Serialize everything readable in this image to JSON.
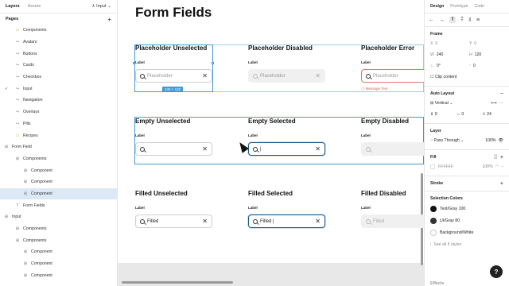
{
  "layers_panel": {
    "tab_layers": "Layers",
    "tab_assets": "Assets",
    "page_selector": "Input",
    "pages_header": "Pages",
    "rows": [
      {
        "label": "Components",
        "icon": "folder-icon",
        "indent": 1
      },
      {
        "label": "Avatars",
        "icon": "page-link-icon",
        "indent": 1
      },
      {
        "label": "Buttons",
        "icon": "page-link-icon",
        "indent": 1
      },
      {
        "label": "Cards",
        "icon": "page-link-icon",
        "indent": 1
      },
      {
        "label": "Checkbox",
        "icon": "page-link-icon",
        "indent": 1
      },
      {
        "label": "Input",
        "icon": "page-link-icon",
        "indent": 1,
        "checked": true
      },
      {
        "label": "Navigation",
        "icon": "page-link-icon",
        "indent": 1
      },
      {
        "label": "Overlays",
        "icon": "page-link-icon",
        "indent": 1
      },
      {
        "label": "Pills",
        "icon": "page-link-icon",
        "indent": 1
      },
      {
        "label": "Recipes",
        "icon": "folder-icon",
        "indent": 1
      },
      {
        "label": "Form Field",
        "icon": "frame-icon",
        "indent": 0
      },
      {
        "label": "Components",
        "icon": "frame-icon",
        "indent": 1
      },
      {
        "label": "Component",
        "icon": "frame-icon",
        "indent": 2
      },
      {
        "label": "Component",
        "icon": "frame-icon",
        "indent": 2
      },
      {
        "label": "Component",
        "icon": "frame-icon",
        "indent": 2,
        "selected": true
      },
      {
        "label": "Form Fields",
        "icon": "text-icon",
        "indent": 1
      },
      {
        "label": "Input",
        "icon": "frame-icon",
        "indent": 0
      },
      {
        "label": "Components",
        "icon": "frame-icon",
        "indent": 1
      },
      {
        "label": "Components",
        "icon": "frame-icon",
        "indent": 1
      },
      {
        "label": "Component",
        "icon": "frame-icon",
        "indent": 2
      },
      {
        "label": "Component",
        "icon": "frame-icon",
        "indent": 2
      },
      {
        "label": "Component",
        "icon": "frame-icon",
        "indent": 2
      }
    ]
  },
  "canvas": {
    "title": "Form Fields",
    "selection_size": "240 × 120",
    "fields": [
      {
        "title": "Placeholder Unselected",
        "label": "Label",
        "value": "Placeholder",
        "variant": "white",
        "placeholder": true
      },
      {
        "title": "Placeholder Disabled",
        "label": "Label",
        "value": "Placeholder",
        "variant": "disabled",
        "placeholder": true
      },
      {
        "title": "Placeholder Error",
        "label": "Label",
        "value": "Placeholder",
        "variant": "error",
        "placeholder": true,
        "error": "Message Text"
      },
      {
        "title": "Empty Unselected",
        "label": "Label",
        "value": "",
        "variant": "white"
      },
      {
        "title": "Empty Selected",
        "label": "Label",
        "value": "|",
        "variant": "selected"
      },
      {
        "title": "Empty Disabled",
        "label": "Label",
        "value": "",
        "variant": "disabled"
      },
      {
        "title": "Filled Unselected",
        "label": "Label",
        "value": "Filled",
        "variant": "white"
      },
      {
        "title": "Filled Selected",
        "label": "Label",
        "value": "Filled |",
        "variant": "selected"
      },
      {
        "title": "Filled Disabled",
        "label": "Label",
        "value": "Filled",
        "variant": "disabled"
      }
    ]
  },
  "design_panel": {
    "tab_design": "Design",
    "tab_prototype": "Prototype",
    "tab_code": "Code",
    "frame_label": "Frame",
    "x": "0",
    "y": "0",
    "w": "240",
    "h": "120",
    "rotation": "0°",
    "radius": "0",
    "clip_content": "Clip content",
    "auto_layout": "Auto Layout",
    "direction": "Vertical",
    "gap": "0",
    "padding_h": "0",
    "padding_v": "24",
    "layer_header": "Layer",
    "blend": "Pass Through",
    "opacity": "100%",
    "fill_header": "Fill",
    "fill_hex": "FFFFFF",
    "fill_opacity": "100%",
    "stroke_header": "Stroke",
    "selection_colors_header": "Selection Colors",
    "colors": [
      {
        "name": "Text/Gray 100",
        "hex": "#111111"
      },
      {
        "name": "UI/Gray 80",
        "hex": "#333333"
      },
      {
        "name": "Background/White",
        "hex": "#ffffff"
      }
    ],
    "see_all": "See all 5 styles",
    "effects_header": "Effects",
    "help": "?"
  }
}
